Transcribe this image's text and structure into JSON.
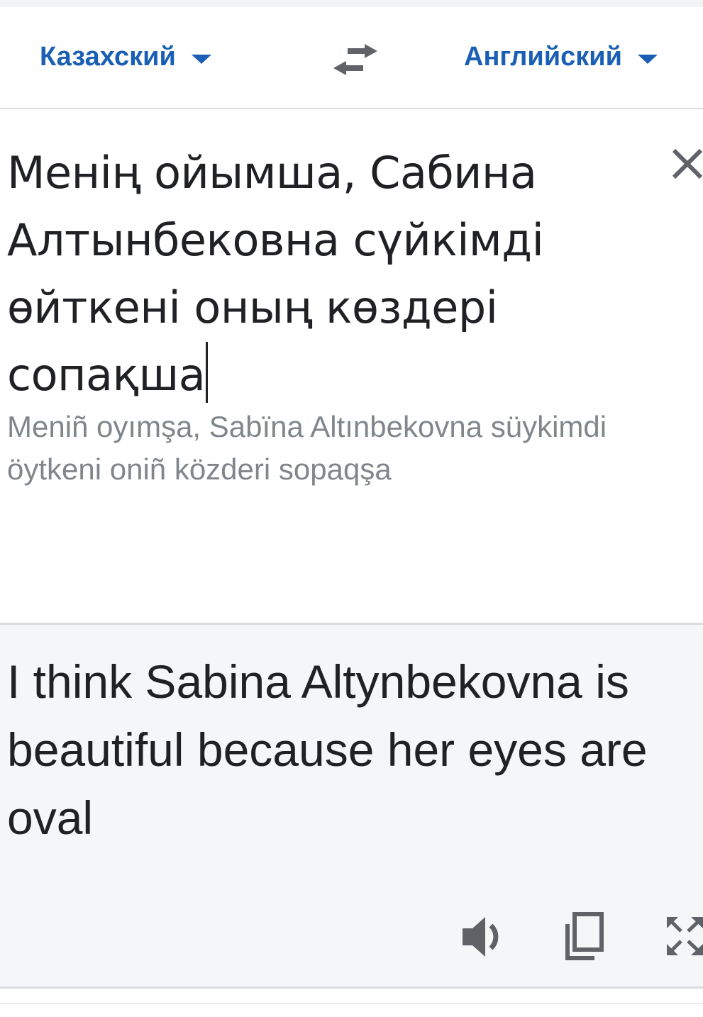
{
  "language_bar": {
    "source_language": "Казахский",
    "target_language": "Английский",
    "swap_icon": "swap-arrows-icon",
    "accent_color": "#1a5fb4"
  },
  "source": {
    "text": "Менің ойымша, Сабина Алтынбековна сүйкімді өйткені оның көздері сопақша",
    "transliteration": "Meniñ oyımşa, Sabïna Altınbekovna süykimdi öytkeni oniñ közderi sopaqşa",
    "clear_icon": "close-icon"
  },
  "result": {
    "text": "I think Sabina Altynbekovna is beautiful because her eyes are oval",
    "actions": {
      "speak_icon": "volume-icon",
      "copy_icon": "copy-icon",
      "fullscreen_icon": "fullscreen-icon"
    },
    "background": "#f5f6f8"
  }
}
